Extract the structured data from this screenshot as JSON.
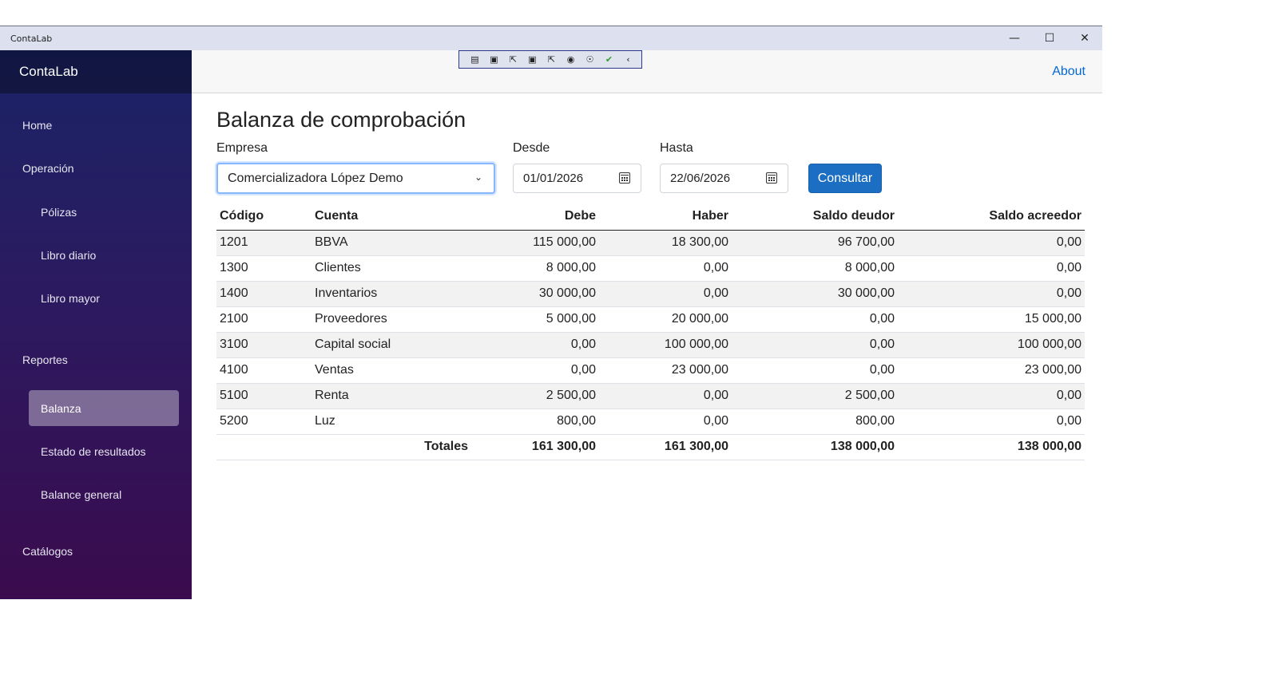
{
  "window": {
    "title": "ContaLab"
  },
  "sidebar": {
    "brand": "ContaLab",
    "home": "Home",
    "operacion": "Operación",
    "polizas": "Pólizas",
    "libro_diario": "Libro diario",
    "libro_mayor": "Libro mayor",
    "reportes": "Reportes",
    "balanza": "Balanza",
    "estado_resultados": "Estado de resultados",
    "balance_general": "Balance general",
    "catalogos": "Catálogos"
  },
  "topbar": {
    "about": "About"
  },
  "page": {
    "title": "Balanza de comprobación"
  },
  "form": {
    "empresa_label": "Empresa",
    "empresa_value": "Comercializadora López Demo",
    "desde_label": "Desde",
    "desde_value": "01/01/2026",
    "hasta_label": "Hasta",
    "hasta_value": "22/06/2026",
    "consultar": "Consultar"
  },
  "table": {
    "headers": [
      "Código",
      "Cuenta",
      "Debe",
      "Haber",
      "Saldo deudor",
      "Saldo acreedor"
    ],
    "rows": [
      [
        "1201",
        "BBVA",
        "115 000,00",
        "18 300,00",
        "96 700,00",
        "0,00"
      ],
      [
        "1300",
        "Clientes",
        "8 000,00",
        "0,00",
        "8 000,00",
        "0,00"
      ],
      [
        "1400",
        "Inventarios",
        "30 000,00",
        "0,00",
        "30 000,00",
        "0,00"
      ],
      [
        "2100",
        "Proveedores",
        "5 000,00",
        "20 000,00",
        "0,00",
        "15 000,00"
      ],
      [
        "3100",
        "Capital social",
        "0,00",
        "100 000,00",
        "0,00",
        "100 000,00"
      ],
      [
        "4100",
        "Ventas",
        "0,00",
        "23 000,00",
        "0,00",
        "23 000,00"
      ],
      [
        "5100",
        "Renta",
        "2 500,00",
        "0,00",
        "2 500,00",
        "0,00"
      ],
      [
        "5200",
        "Luz",
        "800,00",
        "0,00",
        "800,00",
        "0,00"
      ]
    ],
    "totals": {
      "label": "Totales",
      "debe": "161 300,00",
      "haber": "161 300,00",
      "saldo_deudor": "138 000,00",
      "saldo_acreedor": "138 000,00"
    }
  }
}
